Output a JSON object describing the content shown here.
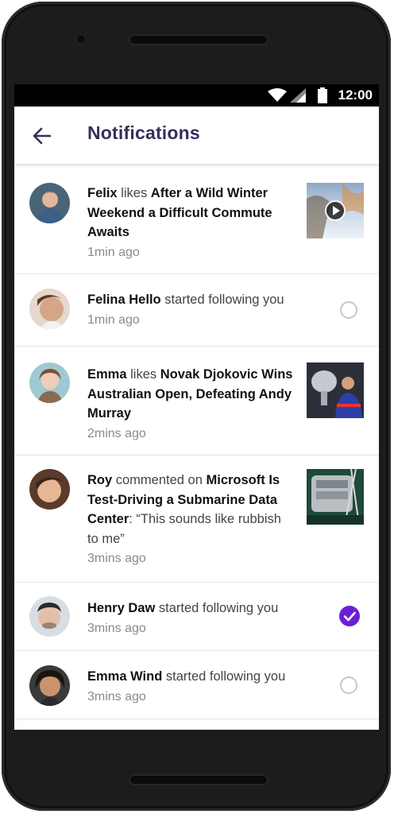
{
  "status": {
    "time": "12:00"
  },
  "header": {
    "title": "Notifications"
  },
  "notifications": [
    {
      "user": "Felix",
      "verb": " likes ",
      "target": "After a Wild Winter Weekend a Difficult Commute Awaits",
      "time": "1min ago",
      "thumb": "video-thumbnail"
    },
    {
      "user": "Felina Hello",
      "verb": " started following you",
      "time": "1min ago",
      "follow_state": "unchecked"
    },
    {
      "user": "Emma",
      "verb": " likes ",
      "target": "Novak Djokovic Wins Australian Open, Defeating Andy Murray",
      "time": "2mins ago",
      "thumb": "trophy-thumbnail"
    },
    {
      "user": "Roy",
      "verb": " commented on ",
      "target": "Microsoft Is Test-Driving a Submarine Data Center",
      "comment": ": “This sounds like rubbish to me”",
      "time": "3mins ago",
      "thumb": "datacenter-thumbnail"
    },
    {
      "user": "Henry Daw",
      "verb": " started following you",
      "time": "3mins ago",
      "follow_state": "checked"
    },
    {
      "user": "Emma Wind",
      "verb": " started following you",
      "time": "3mins ago",
      "follow_state": "unchecked"
    }
  ],
  "colors": {
    "accent": "#6a1fd6",
    "title": "#3a2d5a",
    "meta": "#8a8a8a"
  }
}
